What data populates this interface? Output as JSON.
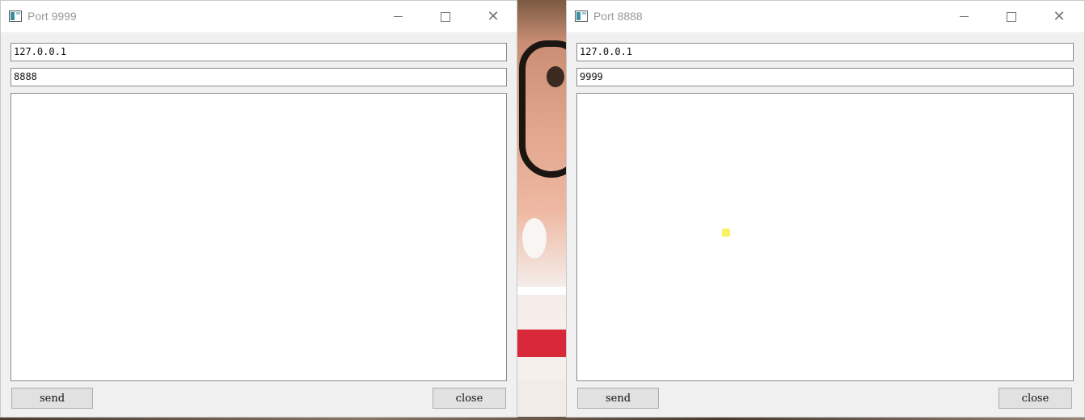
{
  "windows": [
    {
      "title": "Port 9999",
      "ip_value": "127.0.0.1",
      "port_value": "8888",
      "message_text": "",
      "send_label": "send",
      "close_label": "close"
    },
    {
      "title": "Port 8888",
      "ip_value": "127.0.0.1",
      "port_value": "9999",
      "message_text": "",
      "send_label": "send",
      "close_label": "close"
    }
  ],
  "icons": {
    "app": "app-window-icon",
    "minimize": "minimize-icon",
    "maximize": "maximize-icon",
    "close": "close-icon"
  },
  "colors": {
    "window_bg": "#f0f0f0",
    "titlebar_bg": "#ffffff",
    "field_bg": "#ffffff",
    "button_bg": "#e1e1e1",
    "title_text": "#9a9a9a"
  }
}
